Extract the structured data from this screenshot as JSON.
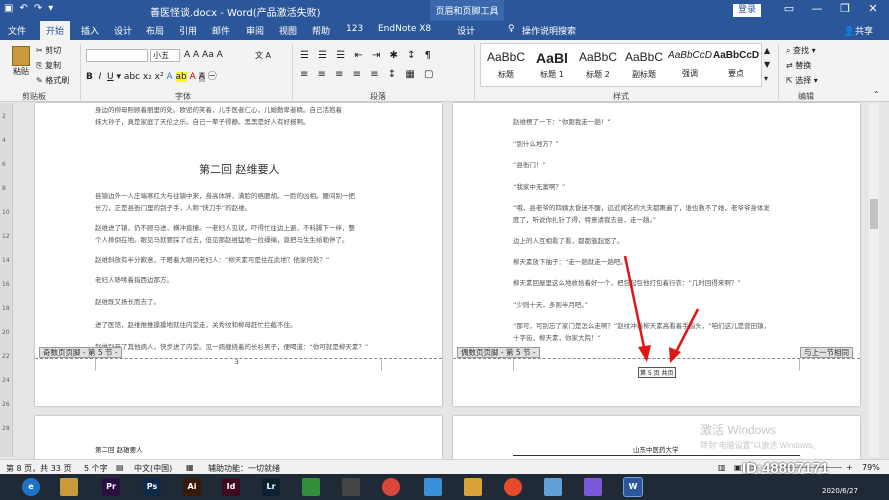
{
  "window": {
    "title": "善医怪谈.docx - Word(产品激活失败)",
    "context_tab_group": "页眉和页脚工具",
    "login": "登录"
  },
  "tabs": [
    "文件",
    "开始",
    "插入",
    "设计",
    "布局",
    "引用",
    "邮件",
    "审阅",
    "视图",
    "帮助",
    "123",
    "EndNote X8",
    "设计"
  ],
  "tell_me": "操作说明搜索",
  "share": "共享",
  "ribbon": {
    "clipboard": {
      "paste": "粘贴",
      "cut": "剪切",
      "copy": "复制",
      "format_painter": "格式刷",
      "label": "剪贴板"
    },
    "font": {
      "size": "小五",
      "label": "字体"
    },
    "paragraph_label": "段落",
    "styles": [
      {
        "sample": "AaBbC",
        "name": "标题"
      },
      {
        "sample": "AaBl",
        "name": "标题 1"
      },
      {
        "sample": "AaBbC",
        "name": "标题 2"
      },
      {
        "sample": "AaBbC",
        "name": "副标题"
      },
      {
        "sample": "AaBbCcD",
        "name": "强调"
      },
      {
        "sample": "AaBbCcD",
        "name": "要点"
      }
    ],
    "styles_label": "样式",
    "editing": {
      "find": "查找",
      "replace": "替换",
      "select": "选择",
      "label": "编辑"
    }
  },
  "ruler_numbers": [
    "2",
    "4",
    "6",
    "8",
    "10",
    "12",
    "14",
    "16",
    "18",
    "20",
    "22",
    "24",
    "26",
    "28"
  ],
  "left_page": {
    "top_lines": [
      "身边的柳母照顾着丽里的处。欧密的笑着，儿手医者仁心，儿婚動卑者精。自己活抱着",
      "抹大孙子，真是家庭了天伦之乐。自己一辈子得静。黑黑是好人有好报啊。"
    ],
    "chapter_title": "第二回 赵维要人",
    "paras": [
      "县镇边外一人庄端寒红大与往镇中来，身高体胖，满脸的络腮胡。一脸的凶相。腰间别一把",
      "长刀，正是县衙门里的刽子手，人称“快刀手”的赵维。",
      "赵维进了镇，仍不顾马进，横冲直撞。一老妇人见状，吓得忙往边上避，不料脚下一绊，整",
      "个人摔倒在地。眼见马就要踩了过去，但见那赵维猛地一拉缰绳，竟把马生生给勒停了。",
      "赵维斜放有半分歉意，干瞪着大眼问老妇人：“柳天素可是住在此地？他家何处？”",
      "老妇人哆嗦着指西边那方。",
      "赵维既又扬长而去了。",
      "进了医馆，赵维推推搡搡地就往内堂走，关秀纹和柳母赶忙拦截不住。",
      "赵维别开了其他病人，快步进了内堂。见一病缠绕着的长衫男子，便喝道：“你可就是柳天素？”"
    ],
    "header_tag": "奇数页页脚 - 第 5 节 -",
    "page_number": "3",
    "next_heading": "第二回  赵雄要人"
  },
  "right_page": {
    "paras": [
      "赵维楞了一下：“你跟我走一趟！”",
      "“到什么地方？”",
      "“县衙门！”",
      "“我家中无案啊？”",
      "“哦，县老爷的四姨太昏迷不醒，远近闻名的大夫都瞧遍了，谁也救不了她，老爷爷身体发",
      "度了，听说你扎针了得，特意请我去县，走一趟。”",
      "边上的人互相看了看，都都皱起悠了。",
      "柳天素放下抽子：“走一趟就走一趟吧。”",
      "柳天素回屋里这么地收拾着好一个，把包起包他打包着行衣：“几时回得来啊？”",
      "“少则十天，多则半月吧。”",
      "“那可，可别忘了家门是怎么走啊？”赵纹冲着柳天素高看着手指头，“咱们这儿是营田镇，",
      "十字街，柳天素，你家大院！”"
    ],
    "header_tag": "偶数页页脚 - 第 5 节 -",
    "link_tag": "与上一节相同",
    "footer_text": "第 5 页  共页",
    "next_header": "山东中医药大学"
  },
  "status": {
    "page": "第 8 页，共 33 页",
    "words": "5 个字",
    "lang": "中文(中国)",
    "accessibility": "辅助功能：一切就绪",
    "zoom": "79%"
  },
  "watermark": {
    "line1": "激活 Windows",
    "line2": "转到“电脑设置”以激活 Windows。"
  },
  "stamp": "ID:48807171",
  "stamp_date": "2020/6/27",
  "taskbar_icons": [
    {
      "label": "e",
      "color": "#1e73c8"
    },
    {
      "label": "",
      "color": "#c89a3b"
    },
    {
      "label": "Pr",
      "color": "#2a1040"
    },
    {
      "label": "Ps",
      "color": "#0d2a4a"
    },
    {
      "label": "Ai",
      "color": "#3a1a05"
    },
    {
      "label": "Id",
      "color": "#3d0a22"
    },
    {
      "label": "Lr",
      "color": "#0c2233"
    },
    {
      "label": "",
      "color": "#2f8f3a"
    },
    {
      "label": "",
      "color": "#444"
    },
    {
      "label": "",
      "color": "#d9463a"
    },
    {
      "label": "",
      "color": "#3a8fd9"
    },
    {
      "label": "",
      "color": "#d9a33a"
    },
    {
      "label": "",
      "color": "#e34b2b"
    },
    {
      "label": "",
      "color": "#5fa1d8"
    },
    {
      "label": "",
      "color": "#7a5ad8"
    },
    {
      "label": "W",
      "color": "#2b579a"
    }
  ]
}
